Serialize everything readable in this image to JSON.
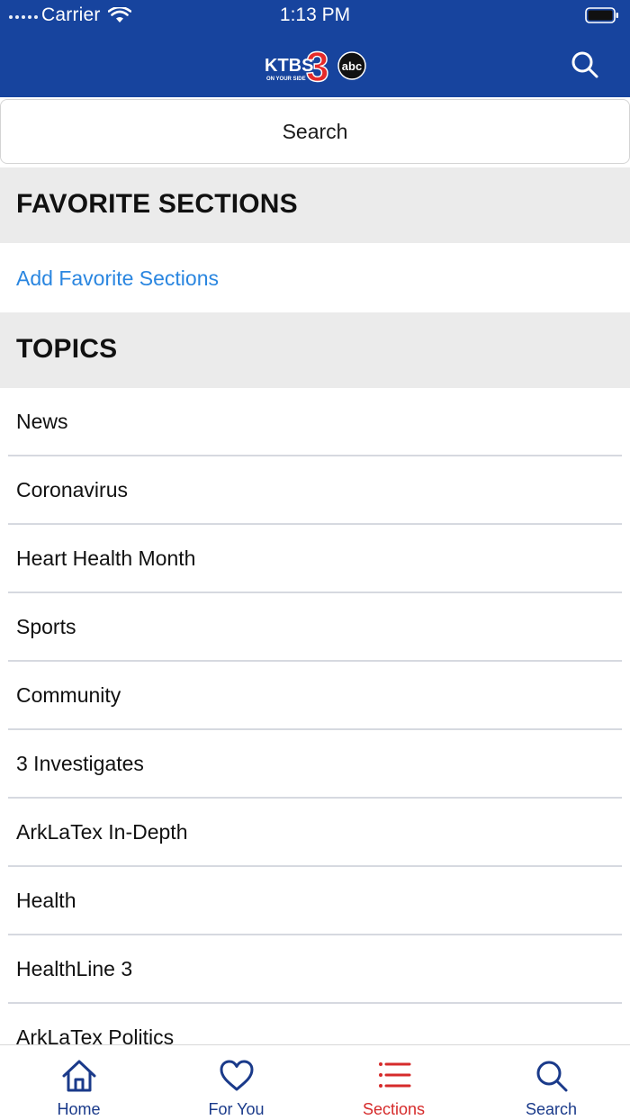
{
  "status_bar": {
    "carrier": "Carrier",
    "time": "1:13 PM"
  },
  "header": {
    "logo_text": "KTBS 3 ON YOUR SIDE abc",
    "search_icon": "search-icon"
  },
  "search": {
    "label": "Search"
  },
  "favorites": {
    "heading": "FAVORITE SECTIONS",
    "add_link": "Add Favorite Sections"
  },
  "topics": {
    "heading": "TOPICS",
    "items": [
      {
        "label": "News"
      },
      {
        "label": "Coronavirus"
      },
      {
        "label": "Heart Health Month"
      },
      {
        "label": "Sports"
      },
      {
        "label": "Community"
      },
      {
        "label": "3 Investigates"
      },
      {
        "label": "ArkLaTex In-Depth"
      },
      {
        "label": "Health"
      },
      {
        "label": "HealthLine 3"
      },
      {
        "label": "ArkLaTex Politics"
      }
    ]
  },
  "tabbar": {
    "tabs": [
      {
        "label": "Home",
        "icon": "home-icon"
      },
      {
        "label": "For You",
        "icon": "heart-icon"
      },
      {
        "label": "Sections",
        "icon": "list-icon",
        "active": true
      },
      {
        "label": "Search",
        "icon": "search-icon"
      }
    ]
  },
  "colors": {
    "header_bg": "#17449e",
    "link": "#2a86e0",
    "active_tab": "#d62b2b",
    "tab_inactive": "#1a3a8a",
    "section_bg": "#ebebeb"
  }
}
